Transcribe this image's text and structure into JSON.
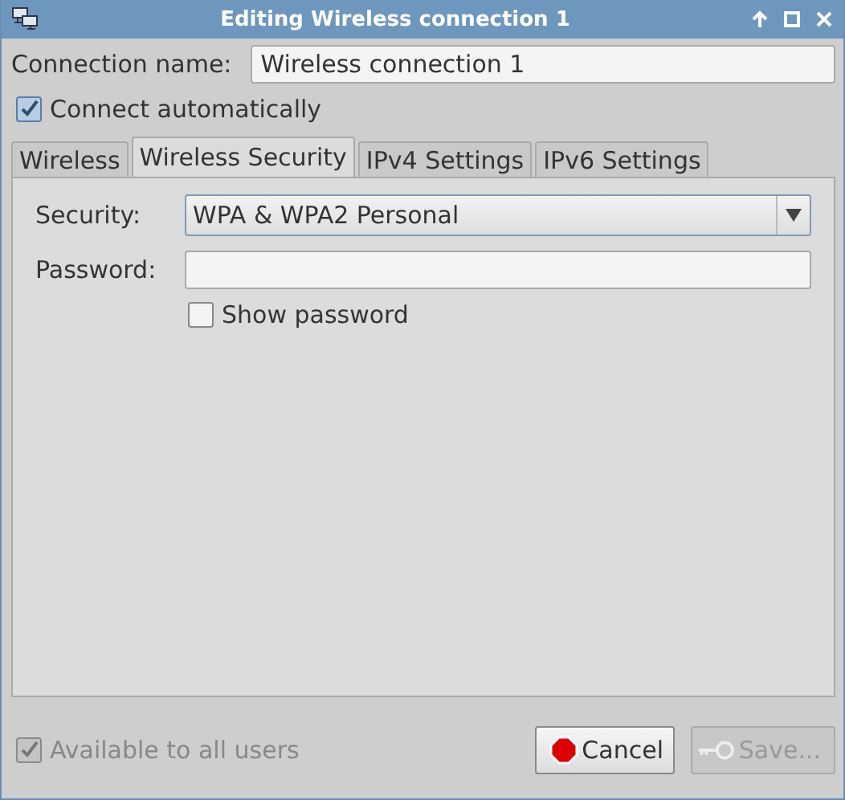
{
  "window": {
    "title": "Editing Wireless connection 1"
  },
  "connection_name": {
    "label": "Connection name:",
    "value": "Wireless connection 1"
  },
  "connect_automatically": {
    "label": "Connect automatically",
    "checked": true
  },
  "tabs": [
    {
      "label": "Wireless",
      "selected": false
    },
    {
      "label": "Wireless Security",
      "selected": true
    },
    {
      "label": "IPv4 Settings",
      "selected": false
    },
    {
      "label": "IPv6 Settings",
      "selected": false
    }
  ],
  "security": {
    "label": "Security:",
    "value": "WPA & WPA2 Personal"
  },
  "password": {
    "label": "Password:"
  },
  "show_password": {
    "label": "Show password",
    "checked": false
  },
  "available_to_all_users": {
    "label": "Available to all users",
    "checked": true,
    "disabled": true
  },
  "buttons": [
    {
      "label": "Cancel",
      "kind": "cancel",
      "disabled": false
    },
    {
      "label": "Save...",
      "kind": "save",
      "disabled": true
    }
  ]
}
